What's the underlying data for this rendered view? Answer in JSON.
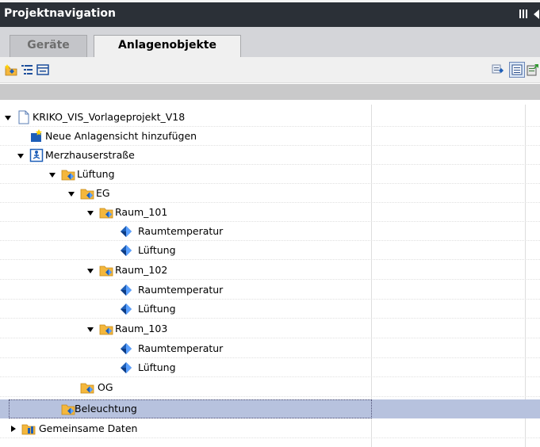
{
  "panel": {
    "title": "Projektnavigation"
  },
  "tabs": [
    {
      "label": "Geräte",
      "active": false
    },
    {
      "label": "Anlagenobjekte",
      "active": true
    }
  ],
  "tree": [
    {
      "label": "KRIKO_VIS_Vorlageprojekt_V18",
      "icon": "project-file-icon",
      "expanded": true
    },
    {
      "label": "Neue Anlagensicht hinzufügen",
      "icon": "add-plant-view-icon"
    },
    {
      "label": "Merzhauserstraße",
      "icon": "plant-view-icon",
      "expanded": true
    },
    {
      "label": "Lüftung",
      "icon": "plant-folder-icon",
      "expanded": true
    },
    {
      "label": "EG",
      "icon": "plant-folder-icon",
      "expanded": true
    },
    {
      "label": "Raum_101",
      "icon": "plant-folder-icon",
      "expanded": true
    },
    {
      "label": "Raumtemperatur",
      "icon": "plant-object-icon"
    },
    {
      "label": "Lüftung",
      "icon": "plant-object-icon"
    },
    {
      "label": "Raum_102",
      "icon": "plant-folder-icon",
      "expanded": true
    },
    {
      "label": "Raumtemperatur",
      "icon": "plant-object-icon"
    },
    {
      "label": "Lüftung",
      "icon": "plant-object-icon"
    },
    {
      "label": "Raum_103",
      "icon": "plant-folder-icon",
      "expanded": true
    },
    {
      "label": "Raumtemperatur",
      "icon": "plant-object-icon"
    },
    {
      "label": "Lüftung",
      "icon": "plant-object-icon"
    },
    {
      "label": "OG",
      "icon": "plant-folder-icon"
    },
    {
      "label": "Beleuchtung",
      "icon": "plant-folder-icon",
      "selected": true
    },
    {
      "label": "Gemeinsame Daten",
      "icon": "common-data-icon",
      "expanded": false
    }
  ],
  "colors": {
    "titlebar": "#2b3037",
    "tab_strip": "#d4d5d9",
    "selection": "#b7c2de",
    "folder": "#f4b73c",
    "object": "#1e5fb8"
  }
}
